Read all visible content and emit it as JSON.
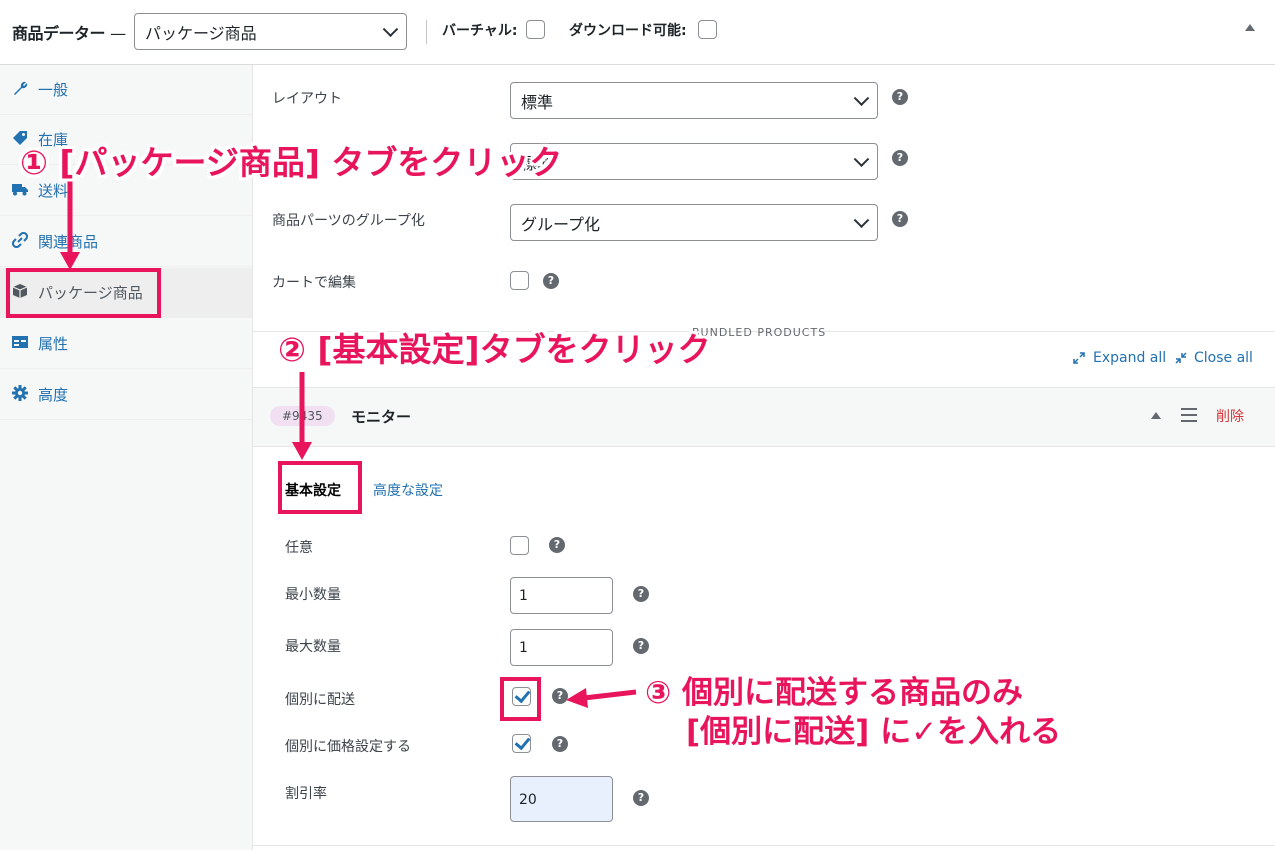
{
  "topbar": {
    "title": "商品データー",
    "title_dash": "—",
    "product_type": "パッケージ商品",
    "virtual_label": "バーチャル:",
    "downloadable_label": "ダウンロード可能:"
  },
  "sidebar": {
    "items": [
      {
        "label": "一般",
        "icon": "wrench-icon"
      },
      {
        "label": "在庫",
        "icon": "tag-icon"
      },
      {
        "label": "送料",
        "icon": "truck-icon"
      },
      {
        "label": "関連商品",
        "icon": "link-icon"
      },
      {
        "label": "パッケージ商品",
        "icon": "box-icon"
      },
      {
        "label": "属性",
        "icon": "table-icon"
      },
      {
        "label": "高度",
        "icon": "gear-icon"
      }
    ]
  },
  "settings": {
    "layout_label": "レイアウト",
    "layout_value": "標準",
    "second_value": "標準",
    "grouping_label": "商品パーツのグループ化",
    "grouping_value": "グループ化",
    "edit_in_cart_label": "カートで編集"
  },
  "bundled": {
    "heading": "BUNDLED PRODUCTS",
    "expand_all": "Expand all",
    "close_all": "Close all",
    "item_id": "#9435",
    "item_name": "モニター",
    "delete": "削除"
  },
  "item_tabs": {
    "basic": "基本設定",
    "advanced": "高度な設定"
  },
  "item_fields": {
    "optional_label": "任意",
    "min_qty_label": "最小数量",
    "min_qty_value": "1",
    "max_qty_label": "最大数量",
    "max_qty_value": "1",
    "ship_individually_label": "個別に配送",
    "price_individually_label": "個別に価格設定する",
    "discount_label": "割引率",
    "discount_value": "20"
  },
  "annotations": {
    "step1": "① [パッケージ商品] タブをクリック",
    "step2": "② [基本設定]タブをクリック",
    "step3_line1": "③ 個別に配送する商品のみ",
    "step3_line2": "[個別に配送] に✓を入れる"
  },
  "colors": {
    "accent": "#2271b1",
    "annotation": "#e8155c",
    "delete": "#d63638"
  }
}
